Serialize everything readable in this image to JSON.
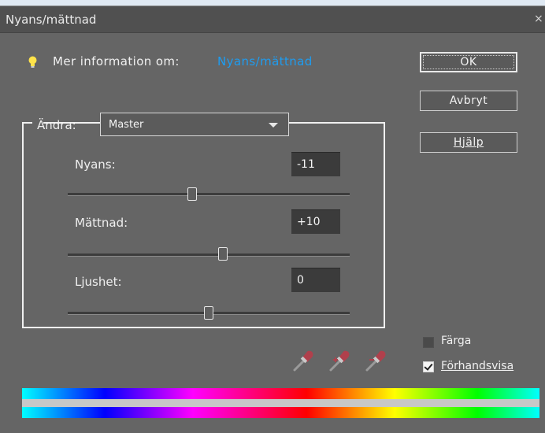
{
  "window": {
    "title": "Nyans/mättnad",
    "close_glyph": "×"
  },
  "info": {
    "label": "Mer information om:",
    "link": "Nyans/mättnad",
    "icon": "lightbulb-icon"
  },
  "buttons": {
    "ok": "OK",
    "cancel": "Avbryt",
    "help": "Hjälp"
  },
  "edit": {
    "label": "Ändra:",
    "selected": "Master"
  },
  "sliders": [
    {
      "label": "Nyans:",
      "value": "-11",
      "level": 0.44
    },
    {
      "label": "Mättnad:",
      "value": "+10",
      "level": 0.55
    },
    {
      "label": "Ljushet:",
      "value": "0",
      "level": 0.5
    }
  ],
  "options": {
    "colorize": {
      "label": "Färga",
      "checked": false
    },
    "preview": {
      "label": "Förhandsvisa",
      "checked": true
    }
  },
  "eyedroppers": [
    "eyedropper-icon",
    "eyedropper-plus-icon",
    "eyedropper-minus-icon"
  ]
}
